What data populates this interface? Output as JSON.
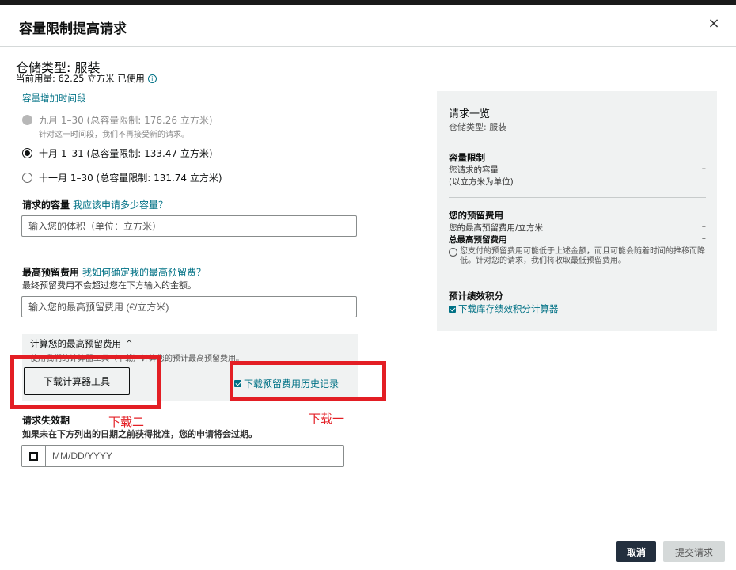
{
  "modal": {
    "title": "容量限制提高请求",
    "close_symbol": "×"
  },
  "storage": {
    "type_label": "仓储类型: 服装",
    "usage_text": "当前用量: 62.25 立方米 已使用",
    "info_symbol": "i"
  },
  "period": {
    "label": "容量增加时间段",
    "options": [
      {
        "label": "九月 1–30 (总容量限制: 176.26 立方米)",
        "sub": "针对这一时间段，我们不再接受新的请求。"
      },
      {
        "label": "十月 1–31 (总容量限制: 133.47 立方米)"
      },
      {
        "label": "十一月 1–30 (总容量限制: 131.74 立方米)"
      }
    ]
  },
  "capacity": {
    "label": "请求的容量",
    "help_link": "我应该申请多少容量？",
    "placeholder": "输入您的体积（单位：立方米）"
  },
  "max_fee": {
    "label": "最高预留费用",
    "help_link": "我如何确定我的最高预留费？",
    "sub": "最终预留费用不会超过您在下方输入的金额。",
    "placeholder": "输入您的最高预留费用 (€/立方米)"
  },
  "calculator": {
    "title": "计算您的最高预留费用",
    "caret": "^",
    "desc": "使用我们的计算器工具（下载）计算您的预计最高预留费用。",
    "button_label": "下载计算器工具",
    "history_link": "下载预留费用历史记录"
  },
  "annotations": {
    "label_two": "下载二",
    "label_one": "下载一"
  },
  "expiry": {
    "label": "请求失效期",
    "sub": "如果未在下方列出的日期之前获得批准，您的申请将会过期。",
    "placeholder": "MM/DD/YYYY"
  },
  "summary": {
    "title": "请求一览",
    "storage_type": "仓储类型: 服装",
    "capacity_head": "容量限制",
    "capacity_row_label": "您请求的容量",
    "capacity_row_sub": "(以立方米为单位)",
    "capacity_value": "–",
    "fee_head": "您的预留费用",
    "fee_row1_label": "您的最高预留费用/立方米",
    "fee_row1_value": "–",
    "fee_row2_label": "总最高预留费用",
    "fee_row2_value": "–",
    "fee_note": "您支付的预留费用可能低于上述金额，而且可能会随着时间的推移而降低。针对您的请求，我们将收取最低预留费用。",
    "score_head": "预计绩效积分",
    "score_link": "下载库存绩效积分计算器"
  },
  "footer": {
    "cancel_label": "取消",
    "submit_label": "提交请求"
  },
  "colors": {
    "accent_link": "#007185",
    "annotation_red": "#e31e24",
    "dark_button": "#232f3e",
    "panel_bg": "#f0f2f2"
  }
}
